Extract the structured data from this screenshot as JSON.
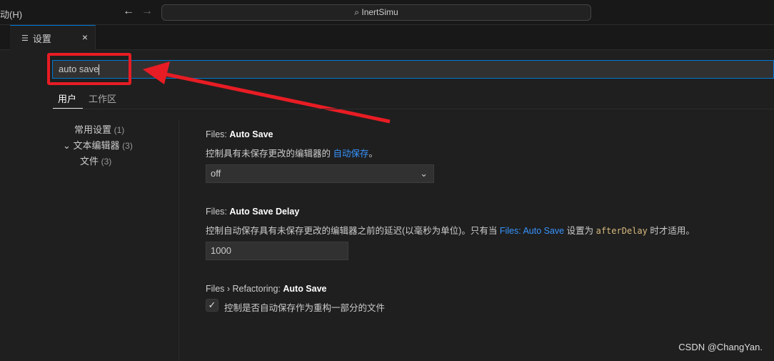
{
  "titlebar": {
    "menu": "动(H)",
    "back_icon": "arrow-left-icon",
    "forward_icon": "arrow-right-icon",
    "command_center": "InertSimu",
    "search_icon": "search-icon"
  },
  "tab": {
    "label": "设置",
    "icon": "settings-list-icon",
    "close": "×"
  },
  "search": {
    "value": "auto save"
  },
  "scopes": [
    {
      "label": "用户",
      "active": true
    },
    {
      "label": "工作区",
      "active": false
    }
  ],
  "tree": [
    {
      "label": "常用设置",
      "count": "(1)"
    },
    {
      "label": "文本编辑器",
      "count": "(3)",
      "expanded": true
    },
    {
      "label": "文件",
      "count": "(3)"
    }
  ],
  "settings": {
    "auto_save": {
      "prefix": "Files: ",
      "name": "Auto Save",
      "desc": "控制具有未保存更改的编辑器的 ",
      "link": "自动保存",
      "desc_end": "。",
      "value": "off"
    },
    "delay": {
      "prefix": "Files: ",
      "name": "Auto Save Delay",
      "desc": "控制自动保存具有未保存更改的编辑器之前的延迟(以毫秒为单位)。只有当 ",
      "link": "Files: Auto Save",
      "desc_mid": " 设置为 ",
      "code": "afterDelay",
      "desc_end": " 时才适用。",
      "value": "1000"
    },
    "refactor": {
      "prefix": "Files › Refactoring: ",
      "name": "Auto Save",
      "desc": "控制是否自动保存作为重构一部分的文件",
      "checked": true
    }
  },
  "watermark": "CSDN @ChangYan.",
  "colors": {
    "accent": "#0078d4",
    "annotation": "#e81c24",
    "link": "#3794ff"
  }
}
